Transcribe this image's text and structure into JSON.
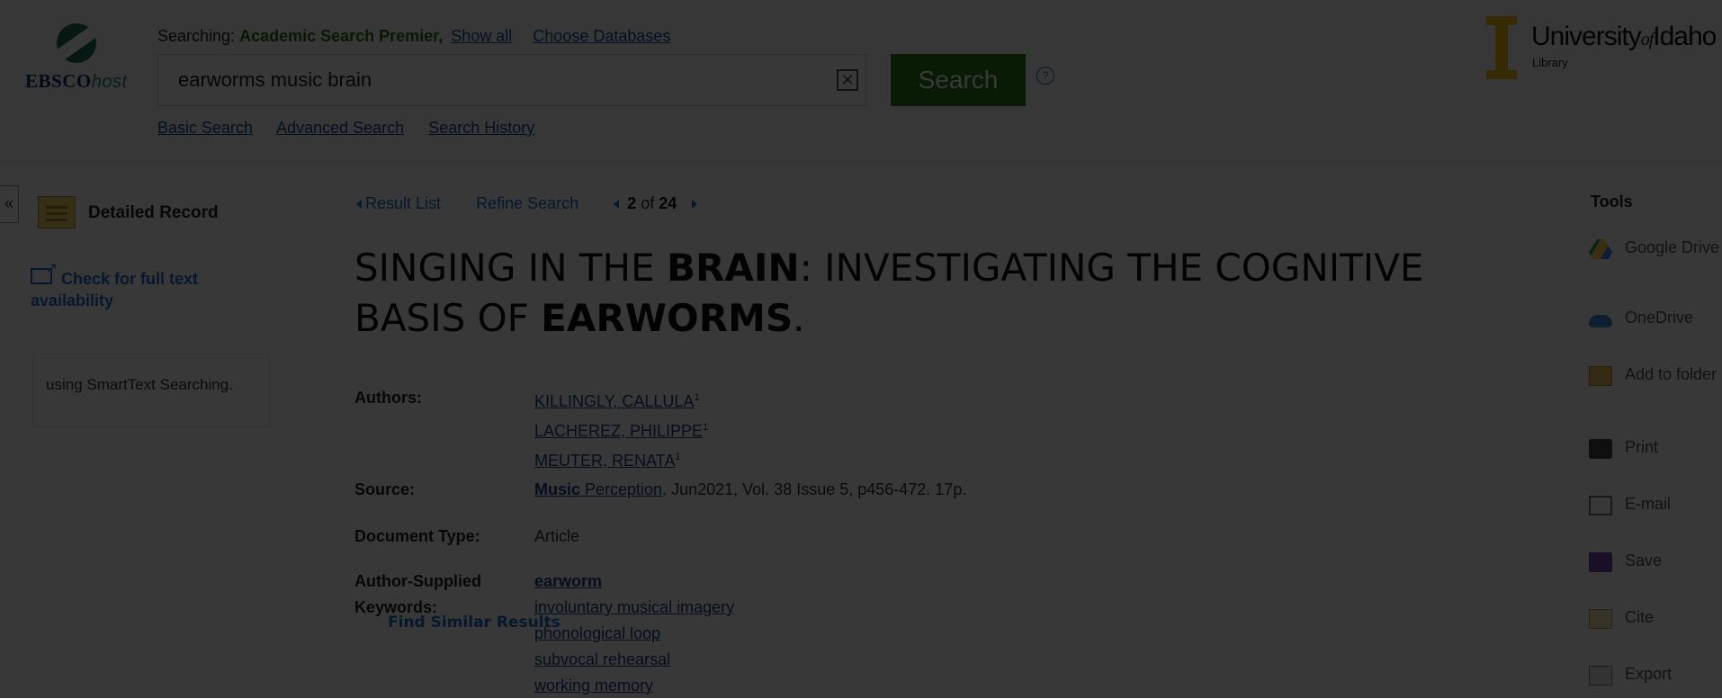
{
  "header": {
    "logo": {
      "name": "EBSCO",
      "suffix": "host"
    },
    "searching_label": "Searching:",
    "database": "Academic Search Premier,",
    "show_all": "Show all",
    "choose_databases": "Choose Databases",
    "search_value": "earworms music brain",
    "clear_icon": "close-icon",
    "search_button": "Search",
    "help": "?",
    "links": [
      "Basic Search",
      "Advanced Search",
      "Search History"
    ],
    "university": {
      "name": "University",
      "of": "of",
      "idaho": "Idaho",
      "sub": "Library"
    }
  },
  "sidebar": {
    "collapse": "«",
    "detailed_record": "Detailed Record",
    "full_text": "Check for full text availability",
    "similar_title": "Find Similar Results",
    "similar_desc": "using SmartText Searching."
  },
  "nav": {
    "result_list": "Result List",
    "refine": "Refine Search",
    "current": "2",
    "of": "of",
    "total": "24"
  },
  "record": {
    "title_parts": [
      {
        "text": "SINGING IN THE ",
        "bold": false
      },
      {
        "text": "BRAIN",
        "bold": true
      },
      {
        "text": ": INVESTIGATING THE COGNITIVE BASIS OF ",
        "bold": false
      },
      {
        "text": "EARWORMS",
        "bold": true
      },
      {
        "text": ".",
        "bold": false
      }
    ],
    "authors_label": "Authors:",
    "authors": [
      {
        "name": "KILLINGLY, CALLULA",
        "sup": "1"
      },
      {
        "name": "LACHEREZ, PHILIPPE",
        "sup": "1"
      },
      {
        "name": "MEUTER, RENATA",
        "sup": "1"
      }
    ],
    "source_label": "Source:",
    "source_bold": "Music",
    "source_link": " Perception",
    "source_rest": ". Jun2021, Vol. 38 Issue 5, p456-472. 17p.",
    "doctype_label": "Document Type:",
    "doctype": "Article",
    "keywords_label": "Author-Supplied Keywords:",
    "keywords": [
      {
        "text": "earworm",
        "bold": true
      },
      {
        "text": "involuntary musical imagery",
        "bold": false
      },
      {
        "text": "phonological loop",
        "bold": false
      },
      {
        "text": "subvocal rehearsal",
        "bold": false
      },
      {
        "text": "working memory",
        "bold": false
      }
    ]
  },
  "tools": {
    "header": "Tools",
    "items": [
      {
        "label": "Google Drive",
        "icon": "google-drive-icon"
      },
      {
        "label": "OneDrive",
        "icon": "onedrive-icon"
      },
      {
        "label": "Add to folder",
        "icon": "folder-icon"
      },
      {
        "label": "Print",
        "icon": "print-icon"
      },
      {
        "label": "E-mail",
        "icon": "email-icon"
      },
      {
        "label": "Save",
        "icon": "save-icon"
      },
      {
        "label": "Cite",
        "icon": "cite-icon"
      },
      {
        "label": "Export",
        "icon": "export-icon"
      }
    ]
  },
  "colors": {
    "accent": "#1a6fd1",
    "search_button": "#2e7d17",
    "database": "#2f6a10",
    "overlay": "#000000"
  }
}
